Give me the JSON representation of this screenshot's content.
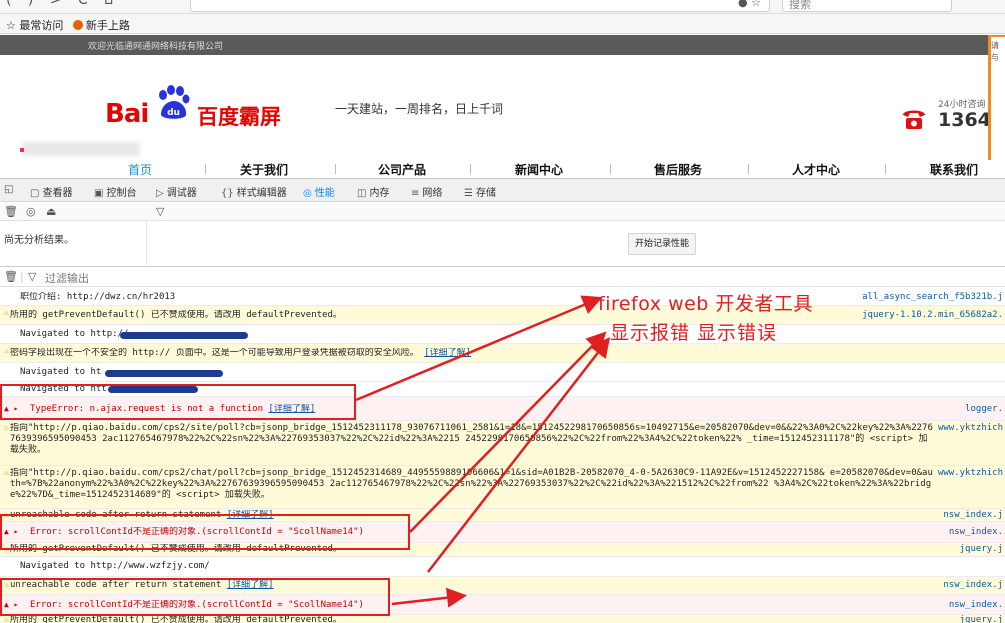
{
  "browser": {
    "nav_glyphs": "( ) > C ⌂",
    "url_icons": "● ☆",
    "search_placeholder": "搜索",
    "bookmarks": [
      "☆ 最常访问",
      "新手上路"
    ]
  },
  "site": {
    "topstrip": "欢迎光临通网通网络科技有限公司",
    "logo_bai": "Bai",
    "logo_du": "du",
    "logo_cn": "百度霸屏",
    "slogan": "一天建站，一周排名，日上千词",
    "hotline_label": "24小时咨询",
    "hotline_number": "1364",
    "side_panel_text": "请\n与\n",
    "nav": [
      "首页",
      "关于我们",
      "公司产品",
      "新闻中心",
      "售后服务",
      "人才中心",
      "联系我们"
    ]
  },
  "devtools": {
    "tabs": [
      {
        "icon": "▢",
        "label": "查看器"
      },
      {
        "icon": "▣",
        "label": "控制台"
      },
      {
        "icon": "▷",
        "label": "调试器"
      },
      {
        "icon": "{}",
        "label": "样式编辑器"
      },
      {
        "icon": "◎",
        "label": "性能"
      },
      {
        "icon": "◫",
        "label": "内存"
      },
      {
        "icon": "≡",
        "label": "网络"
      },
      {
        "icon": "☰",
        "label": "存储"
      }
    ],
    "active_tab": "性能",
    "perf_toolbar_icons": [
      "🗑",
      "◎",
      "⏏",
      "▽"
    ],
    "no_analysis": "尚无分析结果。",
    "record_button": "开始记录性能",
    "filter_placeholder": "过滤输出"
  },
  "console": [
    {
      "level": "info",
      "text": "职位介绍: http://dwz.cn/hr2013",
      "source": "all_async_search_f5b321b.j"
    },
    {
      "level": "warn",
      "text": "所用的 getPreventDefault() 已不赞成使用。请改用 defaultPrevented。",
      "source": "jquery-1.10.2.min_65682a2."
    },
    {
      "level": "info",
      "text": "Navigated to http://",
      "source": ""
    },
    {
      "level": "warn",
      "text": "密码字段出现在一个不安全的 http:// 页面中。这是一个可能导致用户登录凭据被窃取的安全风险。",
      "link": "[详细了解]",
      "source": ""
    },
    {
      "level": "info",
      "text": "Navigated to ht",
      "source": ""
    },
    {
      "level": "info",
      "text": "Navigated to htt",
      "source": ""
    },
    {
      "level": "error",
      "text": "TypeError: n.ajax.request is not a function",
      "link": "[详细了解]",
      "source": "logger."
    },
    {
      "level": "warn",
      "text": "指向\"http://p.qiao.baidu.com/cps2/site/poll?cb=jsonp_bridge_1512452311178_93076711061_2581&1=18&=1512452298170650856s=10492715&e=20582070&dev=0&&22%3A0%2C%22key%22%3A%22767639396595090453 2ac112765467978%22%2C%22sn%22%3A%22769353037%22%2C%22id%22%3A%2215 2452298170650856%22%2C%22from%22%3A4%2C%22token%22% _time=1512452311178\"的 <script> 加载失败。",
      "source": "www.yktzhich"
    },
    {
      "level": "warn",
      "text": "指向\"http://p.qiao.baidu.com/cps2/chat/poll?cb=jsonp_bridge_1512452314689_4495559889106606&1=1&sid=A01B2B-20582070_4-0-5A2630C9-11A92E&v=1512452227158& e=20582070&dev=0&auth=%7B%22anonym%22%3A0%2C%22key%22%3A%22767639396595090453 2ac112765467978%22%2C%22sn%22%3A%22769353037%22%2C%22id%22%3A%221512%2C%22from%22 %3A4%2C%22token%22%3A%22bridge%22%7D&_time=1512452314689\"的 <script> 加载失败。",
      "source": "www.yktzhich"
    },
    {
      "level": "warn",
      "text": "unreachable code after return statement",
      "link": "[详细了解]",
      "source": "nsw_index.j"
    },
    {
      "level": "error",
      "text": "Error: scrollContId不是正确的对象.(scrollContId = \"ScollName14\")",
      "source": "nsw_index."
    },
    {
      "level": "warn",
      "text": "所用的 getPreventDefault() 已不赞成使用。请改用 defaultPrevented。",
      "source": "jquery.j"
    },
    {
      "level": "info",
      "text": "Navigated to http://www.wzfzjy.com/",
      "source": ""
    },
    {
      "level": "warn",
      "text": "unreachable code after return statement",
      "link": "[详细了解]",
      "source": "nsw_index.j"
    },
    {
      "level": "error",
      "text": "Error: scrollContId不是正确的对象.(scrollContId = \"ScollName14\")",
      "source": "nsw_index."
    },
    {
      "level": "warn",
      "text": "所用的 getPreventDefault() 已不赞成使用。请改用 defaultPrevented。",
      "source": "jquery.j"
    }
  ],
  "annotation": {
    "line1": "firefox  web 开发者工具",
    "line2": "显示报错 显示错误",
    "color": "#e02020"
  }
}
